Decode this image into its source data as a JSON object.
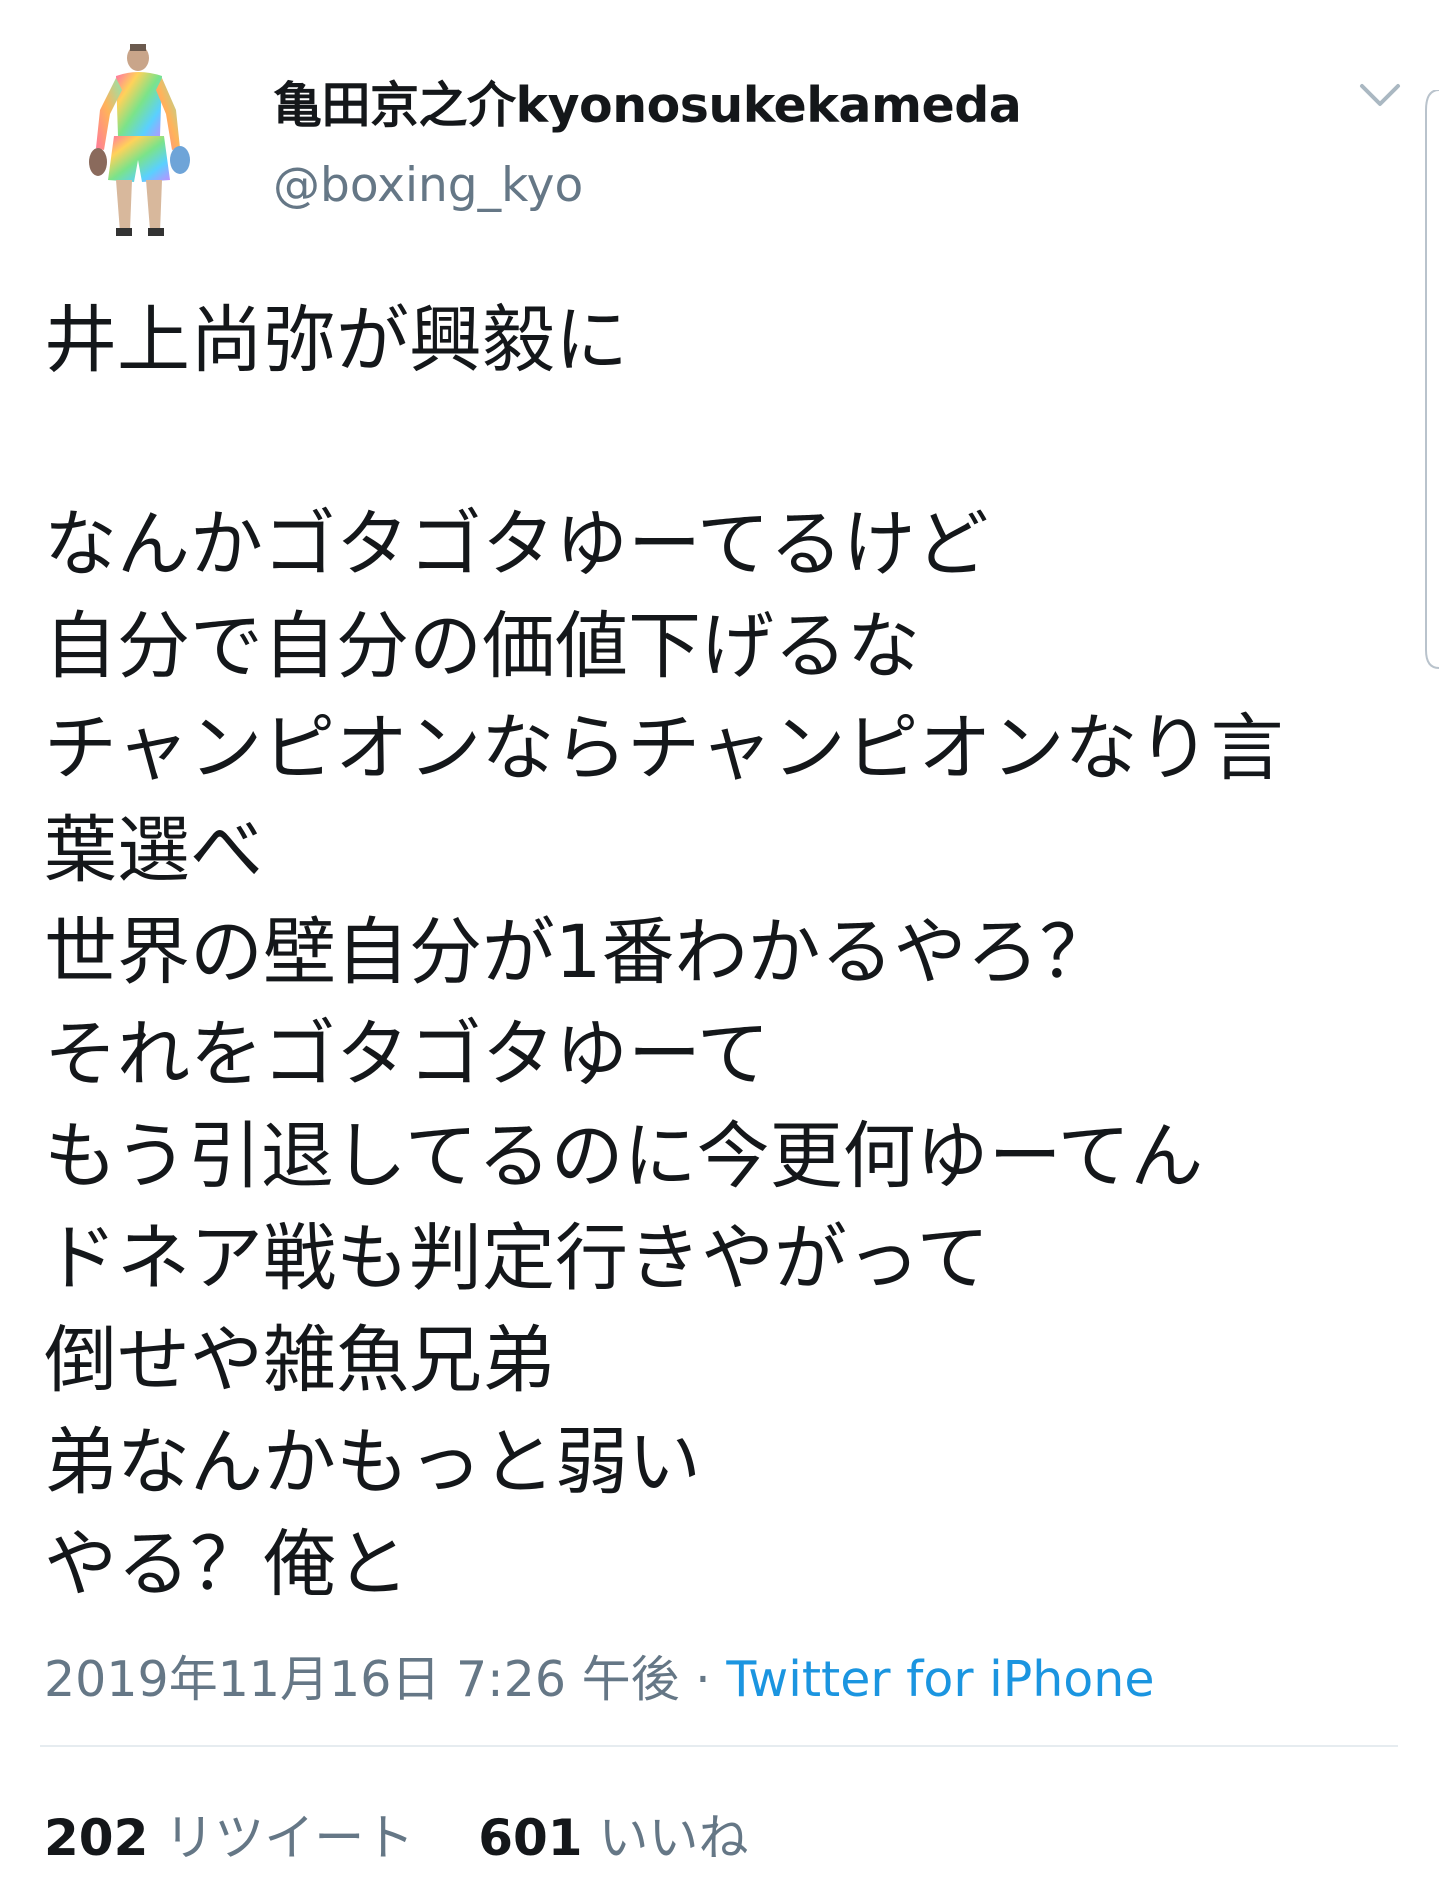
{
  "tweet": {
    "author": {
      "display_name": "亀田京之介kyonosukekameda",
      "handle": "@boxing_kyo"
    },
    "lines": [
      "井上尚弥が興毅に",
      "",
      "なんかゴタゴタゆーてるけど",
      "自分で自分の価値下げるな",
      "チャンピオンならチャンピオンなり言",
      "葉選べ",
      "世界の壁自分が1番わかるやろ？",
      "それをゴタゴタゆーて",
      "もう引退してるのに今更何ゆーてん",
      "ドネア戦も判定行きやがって",
      "倒せや雑魚兄弟",
      "弟なんかもっと弱い",
      "やる？俺と"
    ],
    "timestamp": "2019年11月16日 7:26 午後",
    "separator": " · ",
    "source": "Twitter for iPhone",
    "stats": {
      "retweets_count": "202",
      "retweets_label": "リツイート",
      "likes_count": "601",
      "likes_label": "いいね"
    }
  },
  "icons": {
    "menu": "chevron-down-icon",
    "avatar": "boxer-avatar-image"
  },
  "colors": {
    "text": "#14171a",
    "secondary": "#657786",
    "link": "#1b95e0",
    "divider": "#e6ecf0"
  }
}
